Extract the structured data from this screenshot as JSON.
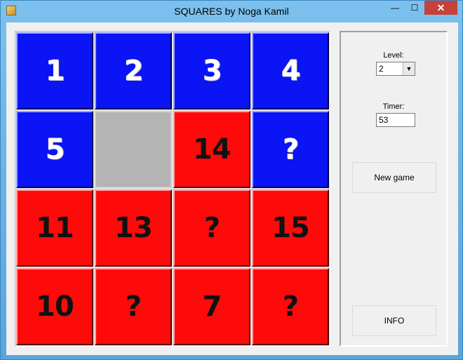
{
  "window": {
    "title": "SQUARES by Noga Kamil",
    "minimize_glyph": "—",
    "maximize_glyph": "☐",
    "close_glyph": "✕"
  },
  "board": {
    "tiles": [
      {
        "label": "1",
        "color": "blue"
      },
      {
        "label": "2",
        "color": "blue"
      },
      {
        "label": "3",
        "color": "blue"
      },
      {
        "label": "4",
        "color": "blue"
      },
      {
        "label": "5",
        "color": "blue"
      },
      {
        "label": "",
        "color": "empty"
      },
      {
        "label": "14",
        "color": "red"
      },
      {
        "label": "?",
        "color": "blue"
      },
      {
        "label": "11",
        "color": "red"
      },
      {
        "label": "13",
        "color": "red"
      },
      {
        "label": "?",
        "color": "red"
      },
      {
        "label": "15",
        "color": "red"
      },
      {
        "label": "10",
        "color": "red"
      },
      {
        "label": "?",
        "color": "red"
      },
      {
        "label": "7",
        "color": "red"
      },
      {
        "label": "?",
        "color": "red"
      }
    ]
  },
  "panel": {
    "level_label": "Level:",
    "level_value": "2",
    "timer_label": "Timer:",
    "timer_value": "53",
    "new_game_label": "New game",
    "info_label": "INFO"
  },
  "colors": {
    "blue_tile": "#0a14f5",
    "red_tile": "#ff0a0a",
    "empty_tile": "#b4b4b4",
    "close_button": "#c7403a"
  }
}
